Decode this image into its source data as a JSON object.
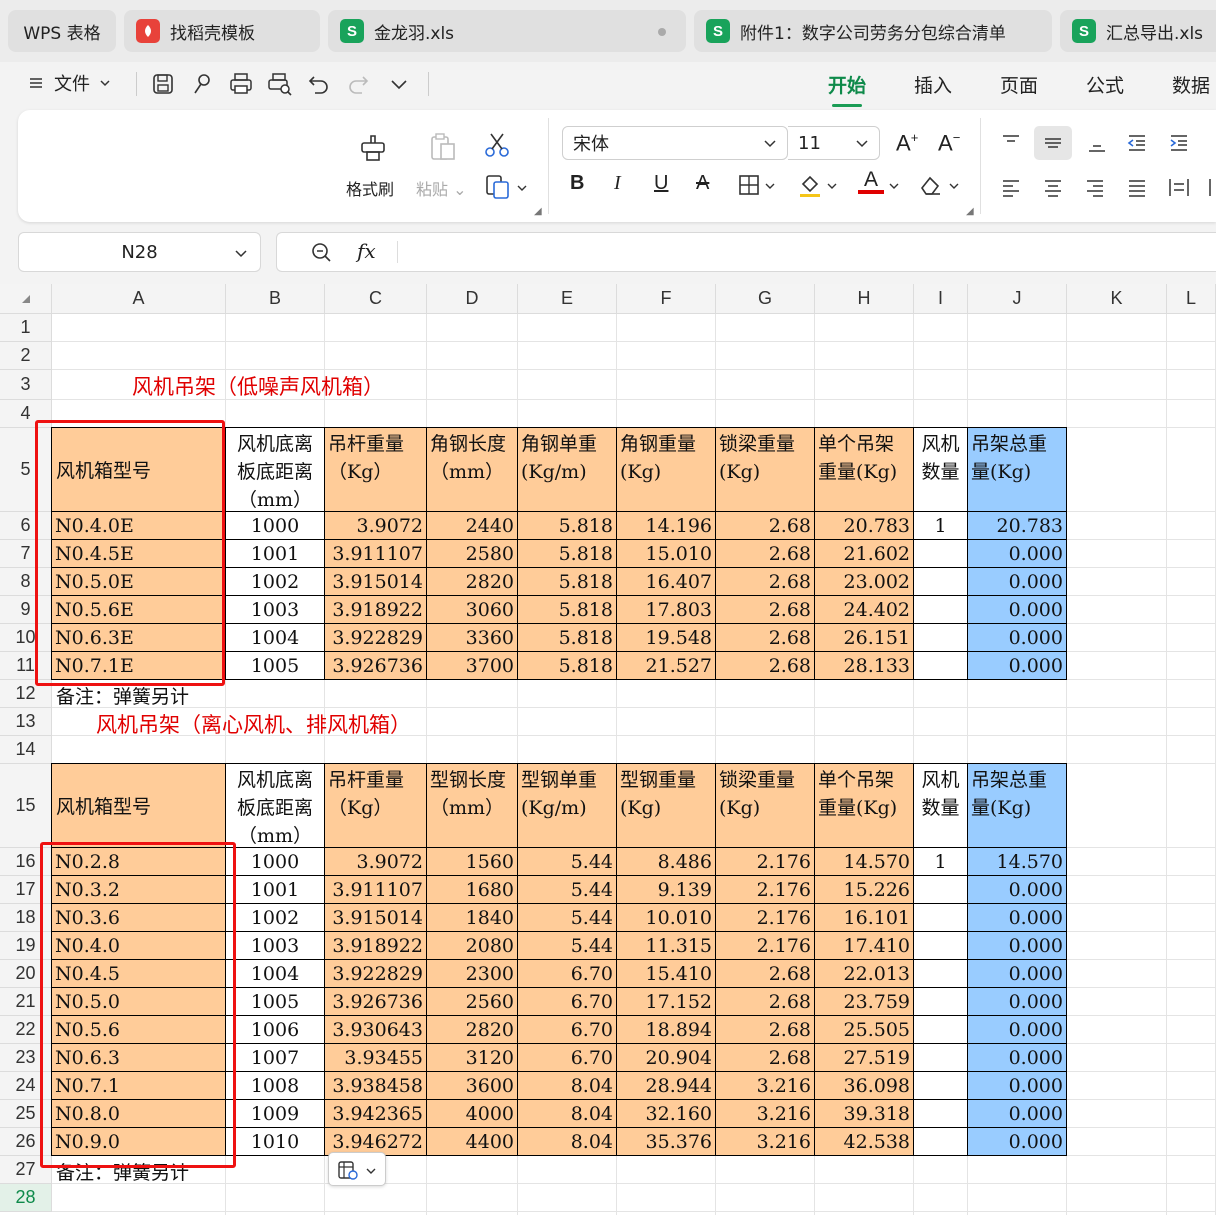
{
  "tabs": [
    {
      "label": "WPS 表格"
    },
    {
      "label": "找稻壳模板",
      "icon": "daoke-icon"
    },
    {
      "label": "金龙羽.xls",
      "icon": "S"
    },
    {
      "label": "附件1：数字公司劳务分包综合清单",
      "icon": "S"
    },
    {
      "label": "汇总导出.xls",
      "icon": "S"
    }
  ],
  "menu": {
    "file_label": "文件",
    "tabs": [
      "开始",
      "插入",
      "页面",
      "公式",
      "数据"
    ],
    "active_tab": "开始"
  },
  "ribbon": {
    "format_painter": "格式刷",
    "paste": "粘贴",
    "font_name": "宋体",
    "font_size": "11"
  },
  "formula_bar": {
    "name_box": "N28",
    "fx": "fx",
    "content": ""
  },
  "grid": {
    "columns": [
      "A",
      "B",
      "C",
      "D",
      "E",
      "F",
      "G",
      "H",
      "I",
      "J",
      "K",
      "L"
    ],
    "rows": [
      "1",
      "2",
      "3",
      "4",
      "5",
      "6",
      "7",
      "8",
      "9",
      "10",
      "11",
      "12",
      "13",
      "14",
      "15",
      "16",
      "17",
      "18",
      "19",
      "20",
      "21",
      "22",
      "23",
      "24",
      "25",
      "26",
      "27",
      "28"
    ],
    "selected_row": "28"
  },
  "table1": {
    "title": "风机吊架（低噪声风机箱）",
    "headers": [
      "风机箱型号",
      "风机底离板底距离（mm）",
      "吊杆重量（Kg）",
      "角钢长度（mm）",
      "角钢单重(Kg/m)",
      "角钢重量(Kg)",
      "锁梁重量(Kg)",
      "单个吊架重量(Kg)",
      "风机数量",
      "吊架总重量(Kg)"
    ],
    "rows": [
      [
        "N0.4.0E",
        "1000",
        "3.9072",
        "2440",
        "5.818",
        "14.196",
        "2.68",
        "20.783",
        "1",
        "20.783"
      ],
      [
        "N0.4.5E",
        "1001",
        "3.911107",
        "2580",
        "5.818",
        "15.010",
        "2.68",
        "21.602",
        "",
        "0.000"
      ],
      [
        "N0.5.0E",
        "1002",
        "3.915014",
        "2820",
        "5.818",
        "16.407",
        "2.68",
        "23.002",
        "",
        "0.000"
      ],
      [
        "N0.5.6E",
        "1003",
        "3.918922",
        "3060",
        "5.818",
        "17.803",
        "2.68",
        "24.402",
        "",
        "0.000"
      ],
      [
        "N0.6.3E",
        "1004",
        "3.922829",
        "3360",
        "5.818",
        "19.548",
        "2.68",
        "26.151",
        "",
        "0.000"
      ],
      [
        "N0.7.1E",
        "1005",
        "3.926736",
        "3700",
        "5.818",
        "21.527",
        "2.68",
        "28.133",
        "",
        "0.000"
      ]
    ],
    "note": "备注：弹簧另计"
  },
  "table2": {
    "title": "风机吊架（离心风机、排风机箱）",
    "headers": [
      "风机箱型号",
      "风机底离板底距离（mm）",
      "吊杆重量（Kg）",
      "型钢长度（mm）",
      "型钢单重(Kg/m)",
      "型钢重量(Kg)",
      "锁梁重量(Kg)",
      "单个吊架重量(Kg)",
      "风机数量",
      "吊架总重量(Kg)"
    ],
    "rows": [
      [
        "N0.2.8",
        "1000",
        "3.9072",
        "1560",
        "5.44",
        "8.486",
        "2.176",
        "14.570",
        "1",
        "14.570"
      ],
      [
        "N0.3.2",
        "1001",
        "3.911107",
        "1680",
        "5.44",
        "9.139",
        "2.176",
        "15.226",
        "",
        "0.000"
      ],
      [
        "N0.3.6",
        "1002",
        "3.915014",
        "1840",
        "5.44",
        "10.010",
        "2.176",
        "16.101",
        "",
        "0.000"
      ],
      [
        "N0.4.0",
        "1003",
        "3.918922",
        "2080",
        "5.44",
        "11.315",
        "2.176",
        "17.410",
        "",
        "0.000"
      ],
      [
        "N0.4.5",
        "1004",
        "3.922829",
        "2300",
        "6.70",
        "15.410",
        "2.68",
        "22.013",
        "",
        "0.000"
      ],
      [
        "N0.5.0",
        "1005",
        "3.926736",
        "2560",
        "6.70",
        "17.152",
        "2.68",
        "23.759",
        "",
        "0.000"
      ],
      [
        "N0.5.6",
        "1006",
        "3.930643",
        "2820",
        "6.70",
        "18.894",
        "2.68",
        "25.505",
        "",
        "0.000"
      ],
      [
        "N0.6.3",
        "1007",
        "3.93455",
        "3120",
        "6.70",
        "20.904",
        "2.68",
        "27.519",
        "",
        "0.000"
      ],
      [
        "N0.7.1",
        "1008",
        "3.938458",
        "3600",
        "8.04",
        "28.944",
        "3.216",
        "36.098",
        "",
        "0.000"
      ],
      [
        "N0.8.0",
        "1009",
        "3.942365",
        "4000",
        "8.04",
        "32.160",
        "3.216",
        "39.318",
        "",
        "0.000"
      ],
      [
        "N0.9.0",
        "1010",
        "3.946272",
        "4400",
        "8.04",
        "35.376",
        "3.216",
        "42.538",
        "",
        "0.000"
      ]
    ],
    "note": "备注：弹簧另计"
  },
  "colors": {
    "header_fill": "#ffcc99",
    "total_fill": "#99ccff",
    "title_text": "#e00000",
    "highlight_box": "#ee1111",
    "accent": "#0e8a4a"
  }
}
